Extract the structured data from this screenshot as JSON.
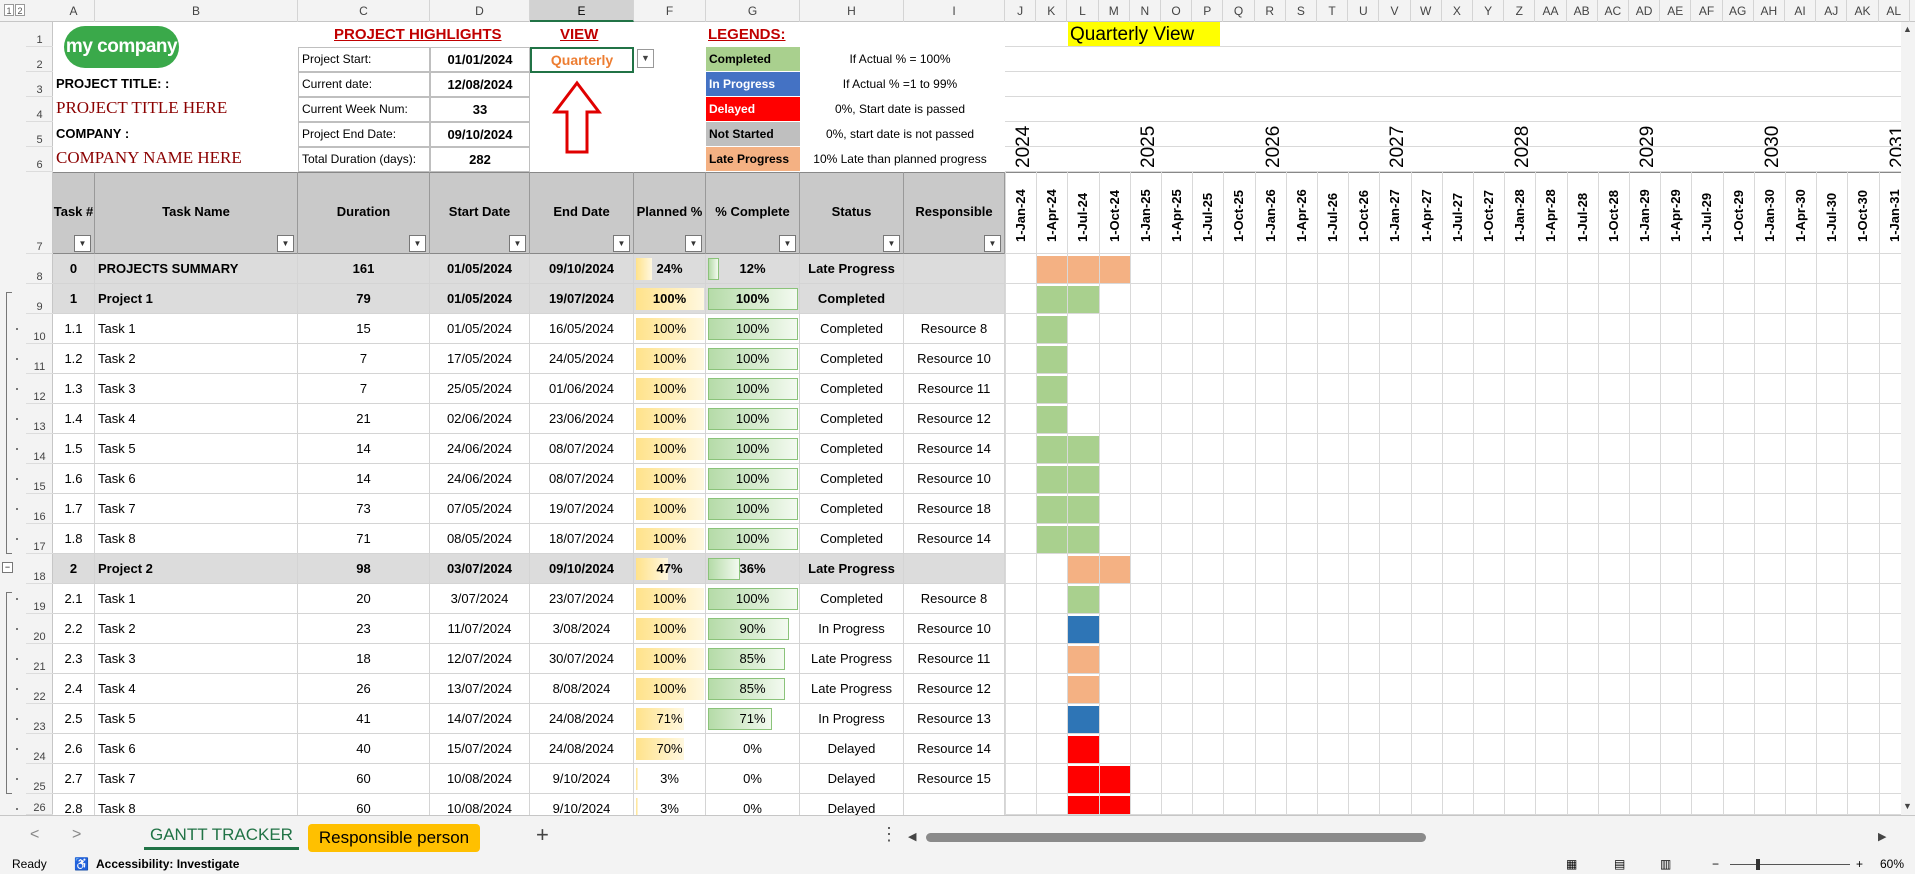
{
  "columns": [
    "A",
    "B",
    "C",
    "D",
    "E",
    "F",
    "G",
    "H",
    "I",
    "J",
    "K",
    "L",
    "M",
    "N",
    "O",
    "P",
    "Q",
    "R",
    "S",
    "T",
    "U",
    "V",
    "W",
    "X",
    "Y",
    "Z",
    "AA",
    "AB",
    "AC",
    "AD",
    "AE",
    "AF",
    "AG",
    "AH",
    "AI",
    "AJ",
    "AK",
    "AL"
  ],
  "outline_levels": [
    "1",
    "2"
  ],
  "rows": [
    "1",
    "2",
    "3",
    "4",
    "5",
    "6",
    "7",
    "8",
    "9",
    "10",
    "11",
    "12",
    "13",
    "14",
    "15",
    "16",
    "17",
    "18",
    "19",
    "20",
    "21",
    "22",
    "23",
    "24",
    "25",
    "26"
  ],
  "logo": "my company",
  "project_title_label": "PROJECT TITLE: :",
  "project_title_value": "PROJECT TITLE HERE",
  "company_label": "COMPANY :",
  "company_value": "COMPANY NAME HERE",
  "highlights": {
    "heading": "PROJECT HIGHLIGHTS",
    "items": [
      {
        "label": "Project Start:",
        "value": "01/01/2024"
      },
      {
        "label": "Current date:",
        "value": "12/08/2024"
      },
      {
        "label": "Current Week Num:",
        "value": "33"
      },
      {
        "label": "Project End Date:",
        "value": "09/10/2024"
      },
      {
        "label": "Total Duration (days):",
        "value": "282"
      }
    ]
  },
  "view": {
    "heading": "VIEW",
    "selected": "Quarterly"
  },
  "legends": {
    "heading": "LEGENDS:",
    "items": [
      {
        "label": "Completed",
        "desc": "If Actual % = 100%",
        "color": "#a9d08e",
        "text_color": "#000000"
      },
      {
        "label": "In Progress",
        "desc": "If Actual % =1 to 99%",
        "color": "#4472c4",
        "text_color": "#ffffff"
      },
      {
        "label": "Delayed",
        "desc": "0%, Start date is passed",
        "color": "#ff0000",
        "text_color": "#ffffff"
      },
      {
        "label": "Not Started",
        "desc": "0%, start date is not passed",
        "color": "#bfbfbf",
        "text_color": "#000000"
      },
      {
        "label": "Late Progress",
        "desc": "10% Late than planned progress",
        "color": "#f4b183",
        "text_color": "#000000"
      }
    ]
  },
  "gantt_title": "Quarterly View",
  "years": [
    "2024",
    "2025",
    "2026",
    "2027",
    "2028",
    "2029",
    "2030",
    "2031"
  ],
  "quarters": [
    "1-Jan-24",
    "1-Apr-24",
    "1-Jul-24",
    "1-Oct-24",
    "1-Jan-25",
    "1-Apr-25",
    "1-Jul-25",
    "1-Oct-25",
    "1-Jan-26",
    "1-Apr-26",
    "1-Jul-26",
    "1-Oct-26",
    "1-Jan-27",
    "1-Apr-27",
    "1-Jul-27",
    "1-Oct-27",
    "1-Jan-28",
    "1-Apr-28",
    "1-Jul-28",
    "1-Oct-28",
    "1-Jan-29",
    "1-Apr-29",
    "1-Jul-29",
    "1-Oct-29",
    "1-Jan-30",
    "1-Apr-30",
    "1-Jul-30",
    "1-Oct-30",
    "1-Jan-31"
  ],
  "table_headers": [
    "Task #",
    "Task Name",
    "Duration",
    "Start Date",
    "End Date",
    "Planned %",
    "% Complete",
    "Status",
    "Responsible"
  ],
  "status_colors": {
    "Completed": "#a9d08e",
    "In Progress": "#2e75b6",
    "Delayed": "#ff0000",
    "Late Progress": "#f4b183"
  },
  "tasks": [
    {
      "num": "0",
      "name": "PROJECTS SUMMARY",
      "duration": "161",
      "start": "01/05/2024",
      "end": "09/10/2024",
      "planned": "24%",
      "planned_frac": 0.24,
      "complete": "12%",
      "complete_frac": 0.12,
      "status": "Late Progress",
      "responsible": "",
      "level": "top",
      "gantt_quarters": [
        1,
        3
      ]
    },
    {
      "num": "1",
      "name": "Project 1",
      "duration": "79",
      "start": "01/05/2024",
      "end": "19/07/2024",
      "planned": "100%",
      "planned_frac": 1.0,
      "complete": "100%",
      "complete_frac": 1.0,
      "status": "Completed",
      "responsible": "",
      "level": "project",
      "gantt_quarters": [
        1,
        2
      ]
    },
    {
      "num": "1.1",
      "name": "Task 1",
      "duration": "15",
      "start": "01/05/2024",
      "end": "16/05/2024",
      "planned": "100%",
      "planned_frac": 1.0,
      "complete": "100%",
      "complete_frac": 1.0,
      "status": "Completed",
      "responsible": "Resource 8",
      "level": "task",
      "gantt_quarters": [
        1,
        1
      ]
    },
    {
      "num": "1.2",
      "name": "Task 2",
      "duration": "7",
      "start": "17/05/2024",
      "end": "24/05/2024",
      "planned": "100%",
      "planned_frac": 1.0,
      "complete": "100%",
      "complete_frac": 1.0,
      "status": "Completed",
      "responsible": "Resource 10",
      "level": "task",
      "gantt_quarters": [
        1,
        1
      ]
    },
    {
      "num": "1.3",
      "name": "Task 3",
      "duration": "7",
      "start": "25/05/2024",
      "end": "01/06/2024",
      "planned": "100%",
      "planned_frac": 1.0,
      "complete": "100%",
      "complete_frac": 1.0,
      "status": "Completed",
      "responsible": "Resource 11",
      "level": "task",
      "gantt_quarters": [
        1,
        1
      ]
    },
    {
      "num": "1.4",
      "name": "Task 4",
      "duration": "21",
      "start": "02/06/2024",
      "end": "23/06/2024",
      "planned": "100%",
      "planned_frac": 1.0,
      "complete": "100%",
      "complete_frac": 1.0,
      "status": "Completed",
      "responsible": "Resource 12",
      "level": "task",
      "gantt_quarters": [
        1,
        1
      ]
    },
    {
      "num": "1.5",
      "name": "Task 5",
      "duration": "14",
      "start": "24/06/2024",
      "end": "08/07/2024",
      "planned": "100%",
      "planned_frac": 1.0,
      "complete": "100%",
      "complete_frac": 1.0,
      "status": "Completed",
      "responsible": "Resource 14",
      "level": "task",
      "gantt_quarters": [
        1,
        2
      ]
    },
    {
      "num": "1.6",
      "name": "Task 6",
      "duration": "14",
      "start": "24/06/2024",
      "end": "08/07/2024",
      "planned": "100%",
      "planned_frac": 1.0,
      "complete": "100%",
      "complete_frac": 1.0,
      "status": "Completed",
      "responsible": "Resource 10",
      "level": "task",
      "gantt_quarters": [
        1,
        2
      ]
    },
    {
      "num": "1.7",
      "name": "Task 7",
      "duration": "73",
      "start": "07/05/2024",
      "end": "19/07/2024",
      "planned": "100%",
      "planned_frac": 1.0,
      "complete": "100%",
      "complete_frac": 1.0,
      "status": "Completed",
      "responsible": "Resource 18",
      "level": "task",
      "gantt_quarters": [
        1,
        2
      ]
    },
    {
      "num": "1.8",
      "name": "Task 8",
      "duration": "71",
      "start": "08/05/2024",
      "end": "18/07/2024",
      "planned": "100%",
      "planned_frac": 1.0,
      "complete": "100%",
      "complete_frac": 1.0,
      "status": "Completed",
      "responsible": "Resource 14",
      "level": "task",
      "gantt_quarters": [
        1,
        2
      ]
    },
    {
      "num": "2",
      "name": "Project 2",
      "duration": "98",
      "start": "03/07/2024",
      "end": "09/10/2024",
      "planned": "47%",
      "planned_frac": 0.47,
      "complete": "36%",
      "complete_frac": 0.36,
      "status": "Late Progress",
      "responsible": "",
      "level": "project",
      "gantt_quarters": [
        2,
        3
      ]
    },
    {
      "num": "2.1",
      "name": "Task 1",
      "duration": "20",
      "start": "3/07/2024",
      "end": "23/07/2024",
      "planned": "100%",
      "planned_frac": 1.0,
      "complete": "100%",
      "complete_frac": 1.0,
      "status": "Completed",
      "responsible": "Resource 8",
      "level": "task",
      "gantt_quarters": [
        2,
        2
      ]
    },
    {
      "num": "2.2",
      "name": "Task 2",
      "duration": "23",
      "start": "11/07/2024",
      "end": "3/08/2024",
      "planned": "100%",
      "planned_frac": 1.0,
      "complete": "90%",
      "complete_frac": 0.9,
      "status": "In Progress",
      "responsible": "Resource 10",
      "level": "task",
      "gantt_quarters": [
        2,
        2
      ]
    },
    {
      "num": "2.3",
      "name": "Task 3",
      "duration": "18",
      "start": "12/07/2024",
      "end": "30/07/2024",
      "planned": "100%",
      "planned_frac": 1.0,
      "complete": "85%",
      "complete_frac": 0.85,
      "status": "Late Progress",
      "responsible": "Resource 11",
      "level": "task",
      "gantt_quarters": [
        2,
        2
      ]
    },
    {
      "num": "2.4",
      "name": "Task 4",
      "duration": "26",
      "start": "13/07/2024",
      "end": "8/08/2024",
      "planned": "100%",
      "planned_frac": 1.0,
      "complete": "85%",
      "complete_frac": 0.85,
      "status": "Late Progress",
      "responsible": "Resource 12",
      "level": "task",
      "gantt_quarters": [
        2,
        2
      ]
    },
    {
      "num": "2.5",
      "name": "Task 5",
      "duration": "41",
      "start": "14/07/2024",
      "end": "24/08/2024",
      "planned": "71%",
      "planned_frac": 0.71,
      "complete": "71%",
      "complete_frac": 0.71,
      "status": "In Progress",
      "responsible": "Resource 13",
      "level": "task",
      "gantt_quarters": [
        2,
        2
      ]
    },
    {
      "num": "2.6",
      "name": "Task 6",
      "duration": "40",
      "start": "15/07/2024",
      "end": "24/08/2024",
      "planned": "70%",
      "planned_frac": 0.7,
      "complete": "0%",
      "complete_frac": 0,
      "status": "Delayed",
      "responsible": "Resource 14",
      "level": "task",
      "gantt_quarters": [
        2,
        2
      ]
    },
    {
      "num": "2.7",
      "name": "Task 7",
      "duration": "60",
      "start": "10/08/2024",
      "end": "9/10/2024",
      "planned": "3%",
      "planned_frac": 0.03,
      "complete": "0%",
      "complete_frac": 0,
      "status": "Delayed",
      "responsible": "Resource 15",
      "level": "task",
      "gantt_quarters": [
        2,
        3
      ]
    },
    {
      "num": "2.8",
      "name": "Task 8",
      "duration": "60",
      "start": "10/08/2024",
      "end": "9/10/2024",
      "planned": "3%",
      "planned_frac": 0.03,
      "complete": "0%",
      "complete_frac": 0,
      "status": "Delayed",
      "responsible": "",
      "level": "task",
      "gantt_quarters": [
        2,
        3
      ]
    }
  ],
  "sheet_tabs": {
    "active": "GANTT TRACKER",
    "other": "Responsible person",
    "other_color": "#ffc000"
  },
  "status_bar": {
    "ready": "Ready",
    "accessibility": "Accessibility: Investigate",
    "zoom": "60%"
  }
}
